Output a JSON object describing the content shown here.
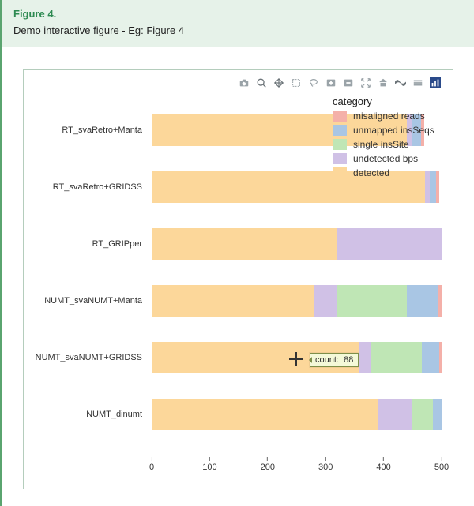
{
  "header": {
    "title": "Figure 4.",
    "description": "Demo interactive figure - Eg: Figure 4"
  },
  "toolbar": {
    "items": [
      {
        "name": "camera-icon",
        "title": "Download plot"
      },
      {
        "name": "zoom-icon",
        "title": "Zoom"
      },
      {
        "name": "pan-icon",
        "title": "Pan"
      },
      {
        "name": "box-select-icon",
        "title": "Box Select"
      },
      {
        "name": "lasso-icon",
        "title": "Lasso Select"
      },
      {
        "name": "zoom-in-icon",
        "title": "Zoom in"
      },
      {
        "name": "zoom-out-icon",
        "title": "Zoom out"
      },
      {
        "name": "autoscale-icon",
        "title": "Autoscale"
      },
      {
        "name": "reset-axes-icon",
        "title": "Reset axes"
      },
      {
        "name": "spike-lines-icon",
        "title": "Toggle Spike Lines"
      },
      {
        "name": "hover-closest-icon",
        "title": "Show closest data on hover"
      },
      {
        "name": "plotly-logo-icon",
        "title": "Plotly"
      }
    ]
  },
  "legend": {
    "title": "category",
    "items": [
      {
        "label": "misaligned reads",
        "color": "#f4b0a9"
      },
      {
        "label": "unmapped insSeqs",
        "color": "#a9c6e4"
      },
      {
        "label": "single insSite",
        "color": "#bfe6b5"
      },
      {
        "label": "undetected bps",
        "color": "#d0c1e6"
      },
      {
        "label": "detected",
        "color": "#fcd79a"
      }
    ]
  },
  "tooltip": {
    "label": "count:",
    "value": "88"
  },
  "chart_data": {
    "type": "bar",
    "orientation": "horizontal",
    "stacked": true,
    "xlabel": "",
    "ylabel": "",
    "xlim": [
      0,
      500
    ],
    "xticks": [
      0,
      100,
      200,
      300,
      400,
      500
    ],
    "legend_title": "category",
    "categories": [
      "RT_svaRetro+Manta",
      "RT_svaRetro+GRIDSS",
      "RT_GRIPper",
      "NUMT_svaNUMT+Manta",
      "NUMT_svaNUMT+GRIDSS",
      "NUMT_dinumt"
    ],
    "series": [
      {
        "name": "detected",
        "color": "#fcd79a",
        "values": [
          440,
          472,
          320,
          280,
          358,
          390
        ]
      },
      {
        "name": "undetected bps",
        "color": "#d0c1e6",
        "values": [
          10,
          8,
          180,
          40,
          20,
          60
        ]
      },
      {
        "name": "single insSite",
        "color": "#bfe6b5",
        "values": [
          0,
          0,
          0,
          120,
          88,
          35
        ]
      },
      {
        "name": "unmapped insSeqs",
        "color": "#a9c6e4",
        "values": [
          15,
          10,
          0,
          55,
          30,
          15
        ]
      },
      {
        "name": "misaligned reads",
        "color": "#f4b0a9",
        "values": [
          5,
          6,
          0,
          5,
          4,
          0
        ]
      }
    ]
  }
}
